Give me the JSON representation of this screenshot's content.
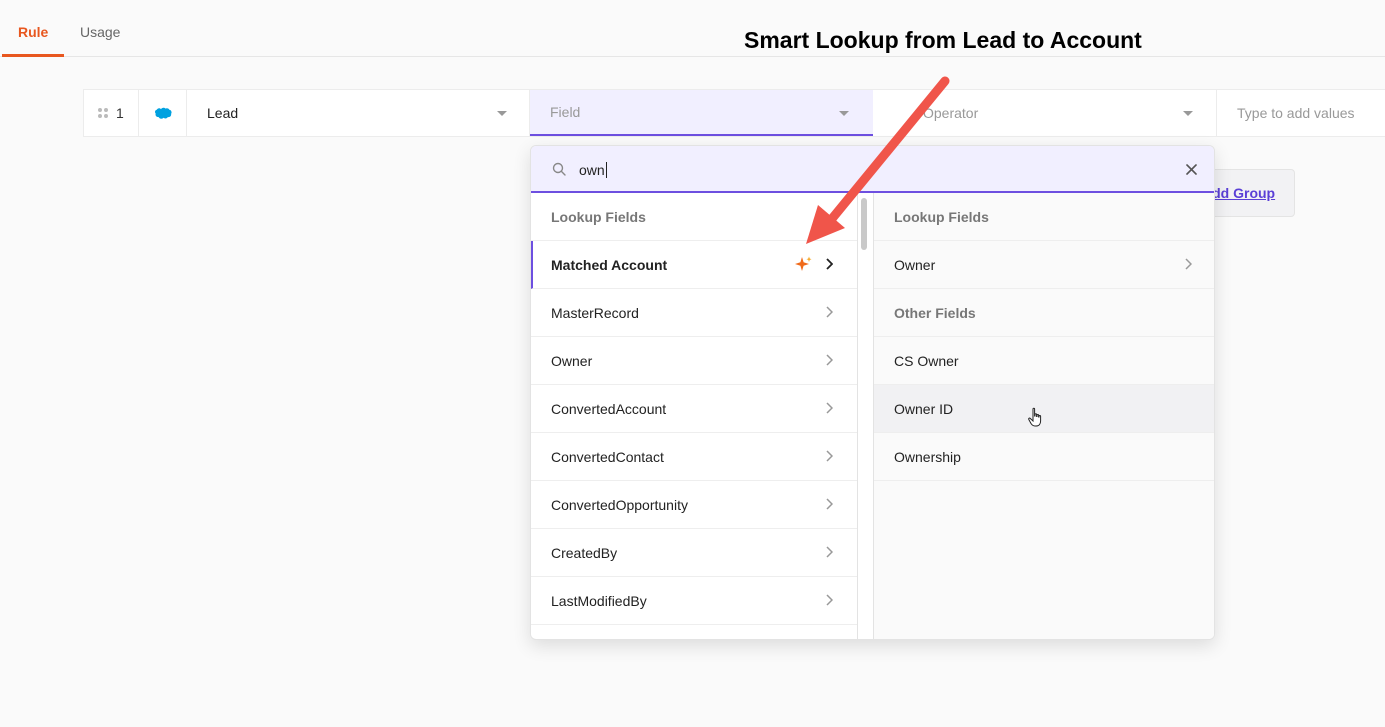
{
  "tabs": [
    {
      "label": "Rule",
      "active": true
    },
    {
      "label": "Usage",
      "active": false
    }
  ],
  "annotation": {
    "title": "Smart Lookup from Lead to Account",
    "arrow_color": "#f0554a"
  },
  "rule_row": {
    "index": "1",
    "object_icon": "salesforce-cloud-icon",
    "object": "Lead",
    "field_placeholder": "Field",
    "operator_placeholder": "Operator",
    "value_placeholder": "Type to add values"
  },
  "add_group_label": "Add Group",
  "dropdown": {
    "search_value": "own",
    "left_column": {
      "header": "Lookup Fields",
      "items": [
        {
          "label": "Matched Account",
          "selected": true,
          "smart": true
        },
        {
          "label": "MasterRecord"
        },
        {
          "label": "Owner"
        },
        {
          "label": "ConvertedAccount"
        },
        {
          "label": "ConvertedContact"
        },
        {
          "label": "ConvertedOpportunity"
        },
        {
          "label": "CreatedBy"
        },
        {
          "label": "LastModifiedBy"
        }
      ]
    },
    "right_column": {
      "lookup_header": "Lookup Fields",
      "lookup_items": [
        {
          "label": "Owner"
        }
      ],
      "other_header": "Other Fields",
      "other_items": [
        {
          "label": "CS Owner"
        },
        {
          "label": "Owner ID",
          "hovered": true
        },
        {
          "label": "Ownership"
        }
      ]
    }
  },
  "colors": {
    "accent": "#6d4fe0",
    "brand_orange": "#e8571f",
    "salesforce_blue": "#00a1e0",
    "sparkle": "#f06a1a"
  }
}
